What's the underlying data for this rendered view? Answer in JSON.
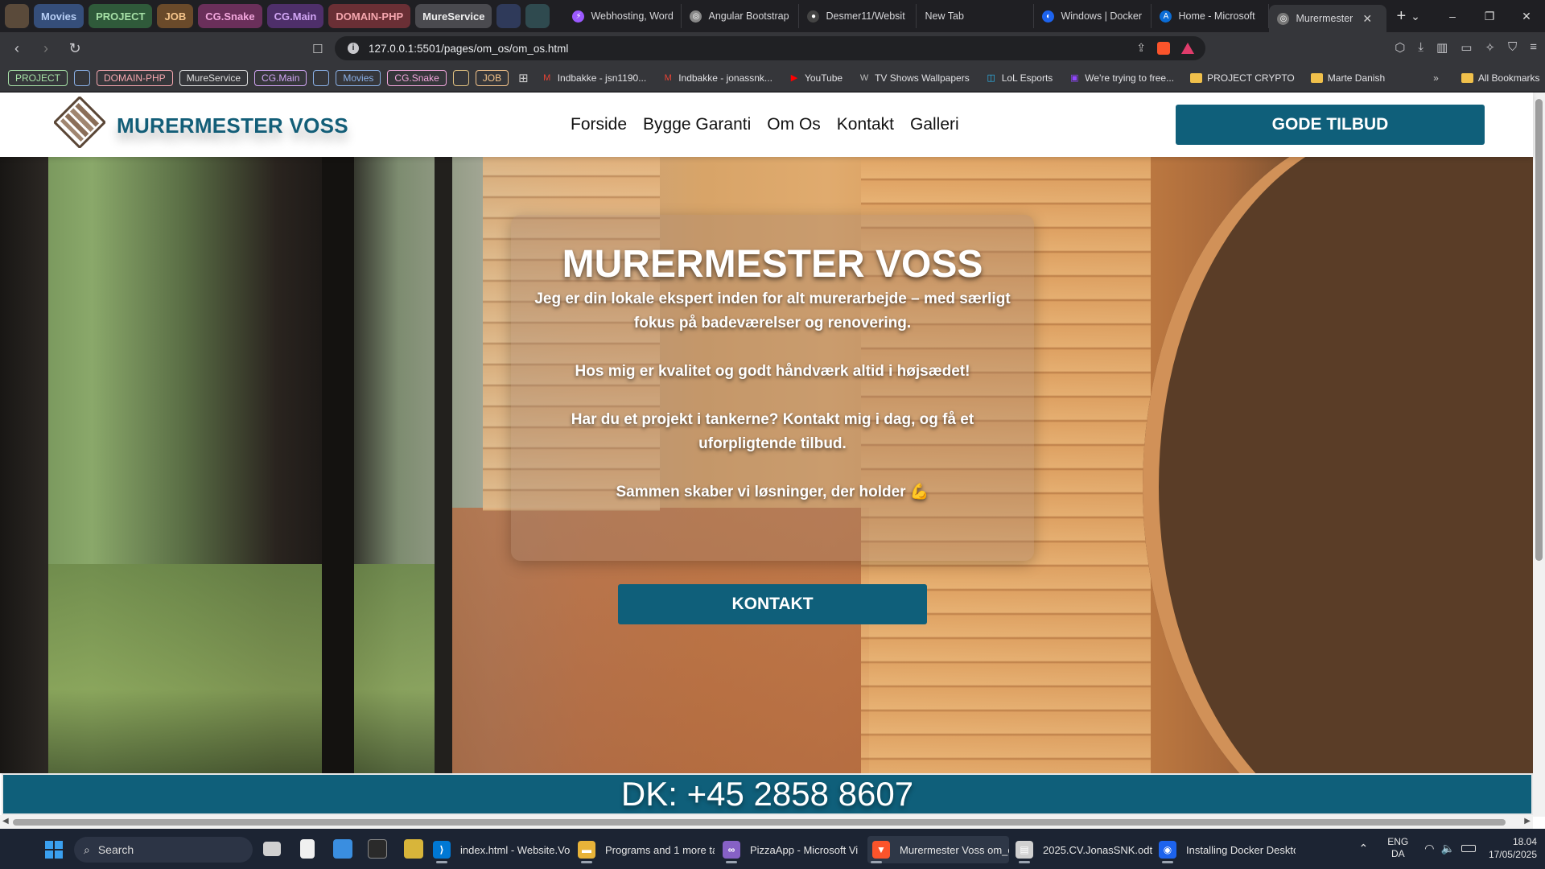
{
  "browser": {
    "tab_groups": [
      {
        "label": "",
        "color": "#5a4a3a",
        "text": "#5a4a3a",
        "square": true
      },
      {
        "label": "Movies",
        "color": "#354e7a",
        "text": "#b8cff5",
        "square": false
      },
      {
        "label": "PROJECT",
        "color": "#2f5a3a",
        "text": "#a6e0a6",
        "square": false
      },
      {
        "label": "JOB",
        "color": "#6a4a2a",
        "text": "#f5c48a",
        "square": false
      },
      {
        "label": "CG.Snake",
        "color": "#6a2f5a",
        "text": "#f2a6dc",
        "square": false
      },
      {
        "label": "CG.Main",
        "color": "#4e2f6a",
        "text": "#d2a6f5",
        "square": false
      },
      {
        "label": "DOMAIN-PHP",
        "color": "#6a2f35",
        "text": "#f5a6ae",
        "square": false
      },
      {
        "label": "MureService",
        "color": "#4a4a4f",
        "text": "#eeeeee",
        "square": false
      },
      {
        "label": "",
        "color": "#2f3a5a",
        "text": "#2f3a5a",
        "square": true
      },
      {
        "label": "",
        "color": "#2f4a4f",
        "text": "#2f4a4f",
        "square": true
      }
    ],
    "tabs": [
      {
        "title": "Webhosting, Word",
        "icon_color": "#9b59ff",
        "icon": "⚡",
        "active": false
      },
      {
        "title": "Angular Bootstrap",
        "icon_color": "#888888",
        "icon": "◎",
        "active": false
      },
      {
        "title": "Desmer11/Websit",
        "icon_color": "#444444",
        "icon": "●",
        "active": false
      },
      {
        "title": "New Tab",
        "icon_color": "",
        "icon": "",
        "active": false
      },
      {
        "title": "Windows | Docker",
        "icon_color": "#1d63ed",
        "icon": "◐",
        "active": false
      },
      {
        "title": "Home - Microsoft",
        "icon_color": "#0a6cd6",
        "icon": "A",
        "active": false
      },
      {
        "title": "Murermester",
        "icon_color": "#777777",
        "icon": "◎",
        "active": true
      }
    ],
    "new_tab_label": "+",
    "close_tab_label": "✕",
    "window_controls": {
      "list": "⌄",
      "minimize": "–",
      "restore": "❐",
      "close": "✕"
    },
    "url": "127.0.0.1:5501/pages/om_os/om_os.html",
    "bookmark_groups": [
      {
        "label": "PROJECT",
        "color": "#a6e0a6"
      },
      {
        "label": "",
        "color": "#8ab0e6"
      },
      {
        "label": "DOMAIN-PHP",
        "color": "#f5a6ae"
      },
      {
        "label": "MureService",
        "color": "#dddddd"
      },
      {
        "label": "CG.Main",
        "color": "#d2a6f5"
      },
      {
        "label": "",
        "color": "#8ab0e6"
      },
      {
        "label": "Movies",
        "color": "#8ab0e6"
      },
      {
        "label": "CG.Snake",
        "color": "#f2a6dc"
      },
      {
        "label": "",
        "color": "#e0c080"
      },
      {
        "label": "JOB",
        "color": "#f5c48a"
      }
    ],
    "bookmarks": [
      {
        "label": "Indbakke - jsn1190...",
        "icon": "M",
        "icon_color": "#ea4335"
      },
      {
        "label": "Indbakke - jonassnk...",
        "icon": "M",
        "icon_color": "#ea4335"
      },
      {
        "label": "YouTube",
        "icon": "▶",
        "icon_color": "#ff0000"
      },
      {
        "label": "TV Shows Wallpapers",
        "icon": "W",
        "icon_color": "#bbbbbb"
      },
      {
        "label": "LoL Esports",
        "icon": "◫",
        "icon_color": "#2cb8f0"
      },
      {
        "label": "We're trying to free...",
        "icon": "▣",
        "icon_color": "#9146ff"
      }
    ],
    "bookmark_folders": [
      "PROJECT CRYPTO",
      "Marte Danish"
    ],
    "bookmarks_overflow": "»",
    "all_bookmarks": "All Bookmarks"
  },
  "site": {
    "brand": "MURERMESTER VOSS",
    "nav": [
      "Forside",
      "Bygge Garanti",
      "Om Os",
      "Kontakt",
      "Galleri"
    ],
    "offer_button": "GODE TILBUD",
    "hero": {
      "title": "MURERMESTER VOSS",
      "paragraphs": [
        "Jeg er din lokale ekspert inden for alt murerarbejde – med særligt fokus på badeværelser og renovering.",
        "Hos mig er kvalitet og godt håndværk altid i højsædet!",
        "Har du et projekt i tankerne? Kontakt mig i dag, og få et uforpligtende tilbud.",
        "Sammen skaber vi løsninger, der holder 💪"
      ],
      "button": "KONTAKT"
    },
    "phone": "DK: +45 2858 8607",
    "colors": {
      "primary": "#0f5f7a",
      "brand_text": "#135e78"
    }
  },
  "taskbar": {
    "search_placeholder": "Search",
    "apps": [
      {
        "label": "index.html - Website.Vo",
        "icon": "⟩",
        "color": "#0078d4",
        "active": false
      },
      {
        "label": "Programs and 1 more ta",
        "icon": "▬",
        "color": "#e8b339",
        "active": false
      },
      {
        "label": "PizzaApp - Microsoft Vi",
        "icon": "∞",
        "color": "#8661c5",
        "active": false
      },
      {
        "label": "Murermester Voss om_c",
        "icon": "▼",
        "color": "#fb542b",
        "active": true
      },
      {
        "label": "2025.CV.JonasSNK.odt -",
        "icon": "▤",
        "color": "#d0d0d0",
        "active": false
      },
      {
        "label": "Installing Docker Deskto",
        "icon": "◉",
        "color": "#1d63ed",
        "active": false
      }
    ],
    "tray": {
      "lang_top": "ENG",
      "lang_bottom": "DA",
      "time": "18.04",
      "date": "17/05/2025"
    }
  }
}
